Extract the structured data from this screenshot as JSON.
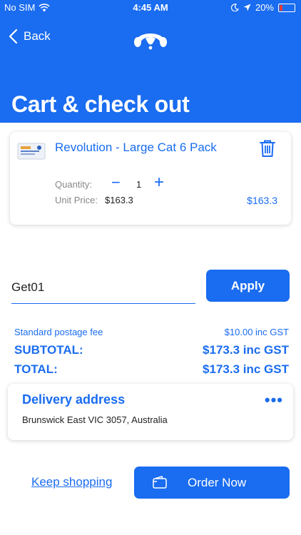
{
  "status_bar": {
    "carrier": "No SIM",
    "time": "4:45 AM",
    "battery": "20%",
    "battery_level": 0.2,
    "icons": [
      "wifi-icon",
      "moon-icon",
      "location-arrow-icon",
      "battery-icon"
    ]
  },
  "nav": {
    "back_label": "Back",
    "logo_icon": "dog-logo-icon"
  },
  "page": {
    "title": "Cart & check out"
  },
  "cart": {
    "items": [
      {
        "name": "Revolution - Large Cat 6 Pack",
        "quantity_label": "Quantity:",
        "quantity": "1",
        "unit_price_label": "Unit Price:",
        "unit_price": "$163.3",
        "line_total": "$163.3"
      }
    ]
  },
  "promo": {
    "value": "Get01",
    "apply_label": "Apply"
  },
  "summary": {
    "postage_label": "Standard postage fee",
    "postage_value": "$10.00 inc GST",
    "subtotal_label": "SUBTOTAL:",
    "subtotal_value": "$173.3 inc GST",
    "total_label": "TOTAL:",
    "total_value": "$173.3 inc GST"
  },
  "delivery": {
    "title": "Delivery address",
    "address": "Brunswick East VIC 3057, Australia",
    "more_label": "•••"
  },
  "footer": {
    "keep_shopping": "Keep shopping",
    "order_now": "Order Now"
  },
  "colors": {
    "brand": "#1a6cf0",
    "battery_low": "#e23b3b"
  }
}
